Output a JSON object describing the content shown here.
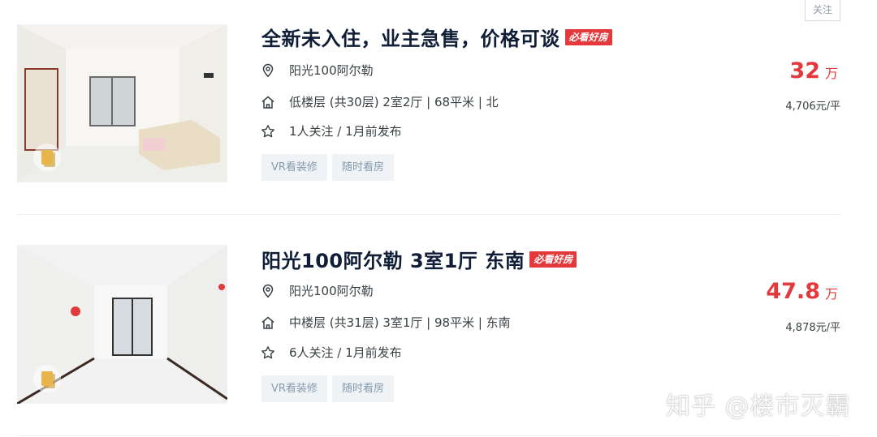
{
  "follow_button": "关注",
  "listings": [
    {
      "title": "全新未入住，业主急售，价格可谈",
      "tag": "必看好房",
      "community": "阳光100阿尔勒",
      "house_info": "低楼层 (共30层) 2室2厅 | 68平米 | 北",
      "follow_info": "1人关注 / 1月前发布",
      "chips": [
        "VR看装修",
        "随时看房"
      ],
      "price": "32",
      "price_unit": "万",
      "unit_price": "4,706元/平"
    },
    {
      "title": "阳光100阿尔勒 3室1厅 东南",
      "tag": "必看好房",
      "community": "阳光100阿尔勒",
      "house_info": "中楼层 (共31层) 3室1厅 | 98平米 | 东南",
      "follow_info": "6人关注 / 1月前发布",
      "chips": [
        "VR看装修",
        "随时看房"
      ],
      "price": "47.8",
      "price_unit": "万",
      "unit_price": "4,878元/平"
    }
  ],
  "watermark": "知乎 @楼市灭霸",
  "colors": {
    "price": "#e4393c",
    "title": "#101d37",
    "chip_bg": "#f0f3f6",
    "chip_text": "#849aae"
  },
  "icons": [
    "location-pin-icon",
    "house-icon",
    "star-icon",
    "vr-icon"
  ]
}
